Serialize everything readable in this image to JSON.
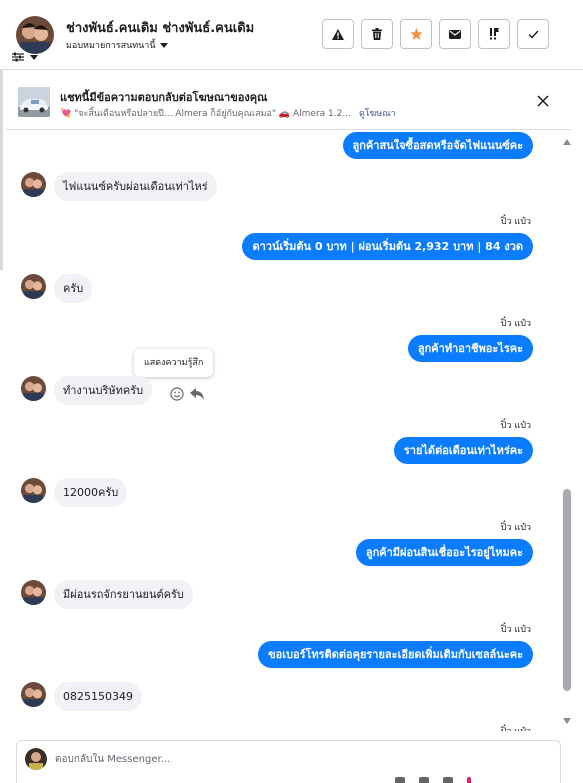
{
  "header": {
    "contact_name": "ช่างพันธ์.คนเดิม ช่างพันธ์.คนเดิม",
    "assign_label": "มอบหมายการสนทนานี้",
    "toolbar": [
      {
        "icon": "warning-icon",
        "name": "spam-button"
      },
      {
        "icon": "trash-icon",
        "name": "delete-button"
      },
      {
        "icon": "star-icon",
        "name": "star-button"
      },
      {
        "icon": "envelope-icon",
        "name": "mark-unread-button"
      },
      {
        "icon": "follow-up-icon",
        "name": "follow-up-button"
      },
      {
        "icon": "check-icon",
        "name": "done-button"
      }
    ],
    "star_color": "#f7923b"
  },
  "ad_banner": {
    "title": "แชทนี้มีข้อความตอบกลับต่อโฆษณาของคุณ",
    "snippet": "💘 \"จะสิ้นเดือนหรือปลายปี... Almera ก็อัยู่กับคุณเสมอ\" 🚗 Almera 1.2...",
    "link_label": "ดูโฆษณา"
  },
  "chat": {
    "brand_blue": "#0a7cff",
    "incoming_bg": "#f0f2f5",
    "sender_name": "ปิ๋ว แป๋ว",
    "messages": [
      {
        "dir": "out",
        "text": "ลูกค้าสนใจซื้อสดหรือจัดไฟแนนซ์คะ"
      },
      {
        "dir": "in",
        "text": "ไฟแนนซ์ครับผ่อนเดือนเท่าไหร่"
      },
      {
        "dir": "out",
        "text": "ดาวน์เริ่มต้น 0 บาท | ผ่อนเริ่มต้น 2,932 บาท | 84 งวด"
      },
      {
        "dir": "in",
        "text": "ครับ"
      },
      {
        "dir": "out",
        "text": "ลูกค้าทำอาชีพอะไรคะ"
      },
      {
        "dir": "in",
        "text": "ทำงานบริษัทครับ"
      },
      {
        "dir": "out",
        "text": "รายได้ต่อเดือนเท่าไหร่คะ"
      },
      {
        "dir": "in",
        "text": "12000ครับ"
      },
      {
        "dir": "out",
        "text": "ลูกค้ามีผ่อนสินเชื่ออะไรอยู่ไหมคะ"
      },
      {
        "dir": "in",
        "text": "มีผ่อนรถจักรยานยนต์ครับ"
      },
      {
        "dir": "out",
        "text": "ขอเบอร์โทรติดต่อคุยรายละเอียดเพิ่มเติมกับเซลล์นะคะ"
      },
      {
        "dir": "in",
        "text": "0825150349"
      }
    ],
    "tooltip": "แสดงความรู้สึก"
  },
  "composer": {
    "placeholder": "ตอบกลับใน Messenger..."
  }
}
